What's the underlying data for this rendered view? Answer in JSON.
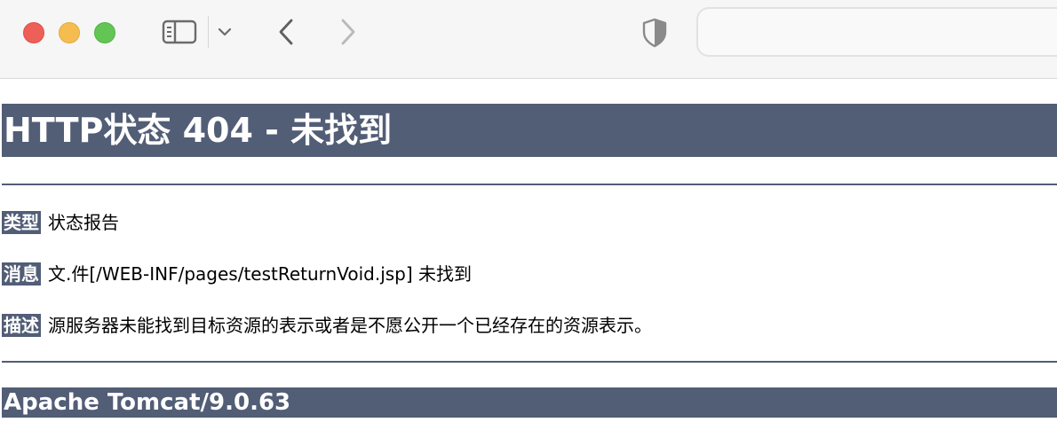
{
  "browser": {
    "window_controls": [
      "close",
      "minimize",
      "zoom"
    ],
    "icons": {
      "sidebar": "sidebar-icon",
      "chevron": "chevron-down-icon",
      "back": "back-arrow-icon",
      "forward": "forward-arrow-icon",
      "privacy": "shield-icon"
    },
    "address": ""
  },
  "page": {
    "title": "HTTP状态 404 - 未找到",
    "rows": [
      {
        "label": "类型",
        "value": "状态报告"
      },
      {
        "label": "消息",
        "value": "文.件[/WEB-INF/pages/testReturnVoid.jsp] 未找到"
      },
      {
        "label": "描述",
        "value": "源服务器未能找到目标资源的表示或者是不愿公开一个已经存在的资源表示。"
      }
    ],
    "footer": "Apache Tomcat/9.0.63"
  },
  "colors": {
    "header_bg": "#525d76",
    "toolbar_bg": "#f6f6f6",
    "close": "#ee5f57",
    "minimize": "#f5bd4f",
    "zoom": "#62c554"
  }
}
